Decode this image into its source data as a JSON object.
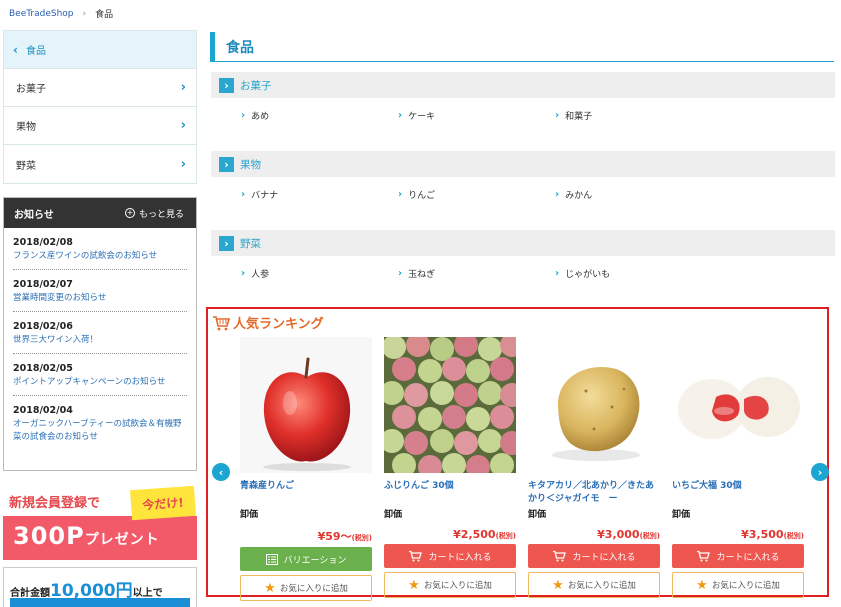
{
  "breadcrumb": {
    "home": "BeeTradeShop",
    "separator": "›",
    "current": "食品"
  },
  "sidebar": {
    "back_label": "食品",
    "items": [
      {
        "label": "お菓子"
      },
      {
        "label": "果物"
      },
      {
        "label": "野菜"
      }
    ]
  },
  "news": {
    "title": "お知らせ",
    "more_label": "もっと見る",
    "entries": [
      {
        "date": "2018/02/08",
        "text": "フランス産ワインの試飲会のお知らせ"
      },
      {
        "date": "2018/02/07",
        "text": "営業時間変更のお知らせ"
      },
      {
        "date": "2018/02/06",
        "text": "世界三大ワイン入荷！"
      },
      {
        "date": "2018/02/05",
        "text": "ポイントアップキャンペーンのお知らせ"
      },
      {
        "date": "2018/02/04",
        "text": "オーガニックハーブティーの試飲会＆有機野菜の試食会のお知らせ"
      }
    ]
  },
  "banner1": {
    "line1": "新規会員登録で",
    "badge": "今だけ!",
    "line2_main": "300P",
    "line2_sub": "プレゼント"
  },
  "banner2": {
    "prefix": "合計金額",
    "amount": "10,000円",
    "suffix": "以上で"
  },
  "main": {
    "title": "食品",
    "sections": [
      {
        "name": "お菓子",
        "links": [
          "あめ",
          "ケーキ",
          "和菓子"
        ]
      },
      {
        "name": "果物",
        "links": [
          "バナナ",
          "りんご",
          "みかん"
        ]
      },
      {
        "name": "野菜",
        "links": [
          "人参",
          "玉ねぎ",
          "じゃがいも"
        ]
      }
    ]
  },
  "ranking": {
    "title": "人気ランキング",
    "wholesale_label": "卸価",
    "fav_label": "お気に入りに追加",
    "products": [
      {
        "name": "青森産りんご",
        "price": "¥59〜",
        "tax": "(税別)",
        "button": "バリエーション",
        "button_type": "variation"
      },
      {
        "name": "ふじりんご 30個",
        "price": "¥2,500",
        "tax": "(税別)",
        "button": "カートに入れる",
        "button_type": "cart"
      },
      {
        "name": "キタアカリ／北あかり／きたあかり＜ジャガイモ　ー",
        "price": "¥3,000",
        "tax": "(税別)",
        "button": "カートに入れる",
        "button_type": "cart"
      },
      {
        "name": "いちご大福 30個",
        "price": "¥3,500",
        "tax": "(税別)",
        "button": "カートに入れる",
        "button_type": "cart"
      }
    ]
  },
  "colors": {
    "accent": "#1aa6d0",
    "price": "#e0362f",
    "cart_button": "#ee5650",
    "variation_button": "#6ab04c",
    "ranking_border": "#e02020",
    "ranking_title": "#e36a2a"
  }
}
